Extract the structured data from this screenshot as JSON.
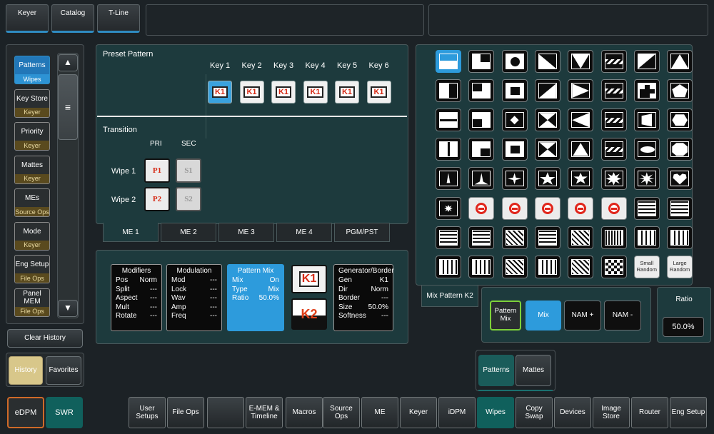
{
  "top_tabs": [
    "Keyer",
    "Catalog",
    "T-Line"
  ],
  "sidebar": {
    "items": [
      {
        "top": "Patterns",
        "bottom": "Wipes",
        "active": true
      },
      {
        "top": "Key Store",
        "bottom": "Keyer"
      },
      {
        "top": "Priority",
        "bottom": "Keyer"
      },
      {
        "top": "Mattes",
        "bottom": "Keyer"
      },
      {
        "top": "MEs",
        "bottom": "Source Ops"
      },
      {
        "top": "Mode",
        "bottom": "Keyer"
      },
      {
        "top": "Eng Setup",
        "bottom": "File Ops"
      },
      {
        "top": "Panel MEM",
        "bottom": "File Ops"
      }
    ],
    "clear_history": "Clear History",
    "history": "History",
    "favorites": "Favorites"
  },
  "preset": {
    "title": "Preset Pattern",
    "keys": [
      "Key 1",
      "Key 2",
      "Key 3",
      "Key 4",
      "Key 5",
      "Key 6"
    ],
    "key_badge": "K1"
  },
  "transition": {
    "title": "Transition",
    "pri": "PRI",
    "sec": "SEC",
    "wipe1": "Wipe 1",
    "wipe2": "Wipe 2",
    "p1": "P1",
    "s1": "S1",
    "p2": "P2",
    "s2": "S2"
  },
  "me_tabs": [
    "ME 1",
    "ME 2",
    "ME 3",
    "ME 4",
    "PGM/PST"
  ],
  "modifiers": {
    "title": "Modifiers",
    "rows": [
      [
        "Pos",
        "Norm"
      ],
      [
        "Split",
        "---"
      ],
      [
        "Aspect",
        "---"
      ],
      [
        "Mult",
        "---"
      ],
      [
        "Rotate",
        "---"
      ]
    ]
  },
  "modulation": {
    "title": "Modulation",
    "rows": [
      [
        "Mod",
        "---"
      ],
      [
        "Lock",
        "---"
      ],
      [
        "Wav",
        "---"
      ],
      [
        "Amp",
        "---"
      ],
      [
        "Freq",
        "---"
      ]
    ]
  },
  "pattern_mix": {
    "title": "Pattern Mix",
    "rows": [
      [
        "Mix",
        "On"
      ],
      [
        "Type",
        "Mix"
      ],
      [
        "Ratio",
        "50.0%"
      ]
    ]
  },
  "k1": "K1",
  "k2": "K2",
  "generator": {
    "title": "Generator/Border",
    "rows": [
      [
        "Gen",
        "K1"
      ],
      [
        "Dir",
        "Norm"
      ],
      [
        "Border",
        "---"
      ],
      [
        "Size",
        "50.0%"
      ],
      [
        "Softness",
        "---"
      ]
    ]
  },
  "patterns": {
    "small_random": "Small Random",
    "large_random": "Large Random"
  },
  "mix_pattern_tab": "Mix Pattern K2",
  "mix_controls": {
    "pattern_mix": "Pattern Mix",
    "mix": "Mix",
    "nam_plus": "NAM +",
    "nam_minus": "NAM -"
  },
  "ratio": {
    "label": "Ratio",
    "value": "50.0%"
  },
  "sub_tabs": [
    "Patterns",
    "Mattes"
  ],
  "edpm": "eDPM",
  "swr": "SWR",
  "bottom_bar": [
    "User Setups",
    "File Ops",
    "",
    "E-MEM & Timeline",
    "Macros",
    "Source Ops",
    "ME",
    "Keyer",
    "iDPM",
    "Wipes",
    "Copy Swap",
    "Devices",
    "Image Store",
    "Router",
    "Eng Setup"
  ],
  "colors": {
    "accent": "#2f8cc2",
    "teal": "#1d3a3d",
    "wipes_active": "#10605c",
    "red_icon": "#e0251b"
  }
}
